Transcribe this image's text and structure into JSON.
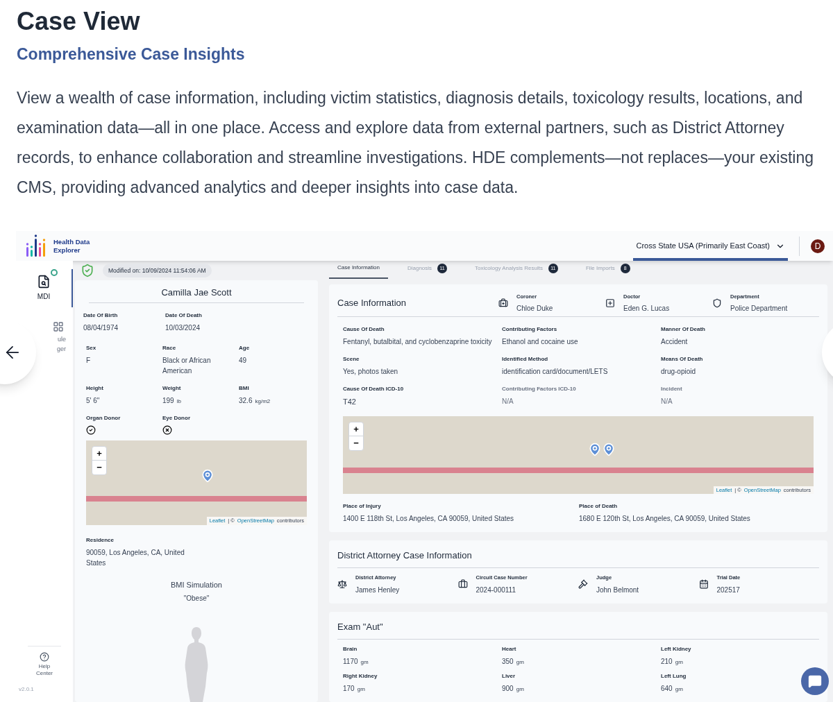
{
  "article": {
    "title": "Case View",
    "subtitle": "Comprehensive Case Insights",
    "body": "View a wealth of case information, including victim statistics, diagnosis details, toxicology results, locations, and examination data—all in one place. Access and explore data from external partners, such as District Attorney records, to enhance collaboration and streamline investigations. HDE complements—not replaces—your existing CMS, providing advanced analytics and deeper insights into case data."
  },
  "app": {
    "logo_text": "Health Data Explorer",
    "region_select": "Cross State USA (Primarily East Coast)",
    "avatar": "D",
    "sidebar": {
      "items": [
        {
          "label": "MDI",
          "selected": true
        },
        {
          "label": "ule ger",
          "selected": false
        }
      ],
      "help": "Help Center",
      "version": "v2.0.1"
    },
    "modified": "Modified on: 10/09/2024 11:54:06 AM",
    "tabs": [
      {
        "label": "Case Information",
        "selected": true
      },
      {
        "label": "Diagnosis",
        "count": "11",
        "selected": false
      },
      {
        "label": "Toxicology Analysis Results",
        "count": "11",
        "selected": false
      },
      {
        "label": "File Imports",
        "count": "8",
        "selected": false
      }
    ],
    "person": {
      "name": "Camilla Jae Scott",
      "dates": [
        {
          "label": "Date Of Birth",
          "value": "08/04/1974"
        },
        {
          "label": "Date Of Death",
          "value": "10/03/2024"
        }
      ],
      "stats": [
        {
          "label": "Sex",
          "value": "F"
        },
        {
          "label": "Race",
          "value": "Black or African American"
        },
        {
          "label": "Age",
          "value": "49"
        },
        {
          "label": "Height",
          "value": "5' 6\""
        },
        {
          "label": "Weight",
          "value": "199",
          "unit": "lb"
        },
        {
          "label": "BMI",
          "value": "32.6",
          "unit": "kg/m2"
        }
      ],
      "donors": [
        {
          "label": "Organ Donor",
          "donor": true
        },
        {
          "label": "Eye Donor",
          "donor": false
        }
      ],
      "map": {
        "zoom_in": "+",
        "zoom_out": "−",
        "leaflet": "Leaflet",
        "separator": "| ©",
        "osm": "OpenStreetMap",
        "suffix": "contributors"
      },
      "residence": {
        "label": "Residence",
        "value": "90059, Los Angeles, CA, United States"
      },
      "bmi_title": "BMI Simulation",
      "bmi_class": "\"Obese\""
    },
    "case_info": {
      "title": "Case Information",
      "people": [
        {
          "kind": "coroner",
          "label": "Coroner",
          "value": "Chloe Duke"
        },
        {
          "kind": "doctor",
          "label": "Doctor",
          "value": "Eden G. Lucas"
        },
        {
          "kind": "department",
          "label": "Department",
          "value": "Police Department"
        }
      ],
      "fields": [
        {
          "label": "Cause Of Death",
          "value": "Fentanyl, butalbital, and cyclobenzaprine toxicity",
          "disabled": false
        },
        {
          "label": "Contributing Factors",
          "value": "Ethanol and cocaine use",
          "disabled": false
        },
        {
          "label": "Manner Of Death",
          "value": "Accident",
          "disabled": false
        },
        {
          "label": "Scene",
          "value": "Yes, photos taken",
          "disabled": false
        },
        {
          "label": "Identified Method",
          "value": "identification card/document/LETS",
          "disabled": false
        },
        {
          "label": "Means Of Death",
          "value": "drug-opioid",
          "disabled": false
        },
        {
          "label": "Cause Of Death ICD-10",
          "value": "T42",
          "disabled": false
        },
        {
          "label": "Contributing Factors ICD-10",
          "value": "N/A",
          "disabled": true
        },
        {
          "label": "Incident",
          "value": "N/A",
          "disabled": true
        }
      ],
      "map": {
        "zoom_in": "+",
        "zoom_out": "−",
        "leaflet": "Leaflet",
        "separator": "| ©",
        "osm": "OpenStreetMap",
        "suffix": "contributors"
      },
      "places": [
        {
          "label": "Place of Injury",
          "value": "1400 E 118th St, Los Angeles, CA 90059, United States"
        },
        {
          "label": "Place of Death",
          "value": "1680 E 120th St, Los Angeles, CA 90059, United States"
        }
      ]
    },
    "da": {
      "title": "District Attorney Case Information",
      "items": [
        {
          "kind": "attorney",
          "label": "District Attorney",
          "value": "James Henley"
        },
        {
          "kind": "case",
          "label": "Circuit Case Number",
          "value": "2024-000111"
        },
        {
          "kind": "judge",
          "label": "Judge",
          "value": "John Belmont"
        },
        {
          "kind": "date",
          "label": "Trial Date",
          "value": "202517"
        }
      ]
    },
    "exam": {
      "title": "Exam \"Aut\"",
      "organs": [
        {
          "label": "Brain",
          "value": "1170",
          "unit": "gm"
        },
        {
          "label": "Heart",
          "value": "350",
          "unit": "gm"
        },
        {
          "label": "Left Kidney",
          "value": "210",
          "unit": "gm"
        },
        {
          "label": "Right Kidney",
          "value": "170",
          "unit": "gm"
        },
        {
          "label": "Liver",
          "value": "900",
          "unit": "gm"
        },
        {
          "label": "Left Lung",
          "value": "640",
          "unit": "gm"
        }
      ]
    }
  }
}
